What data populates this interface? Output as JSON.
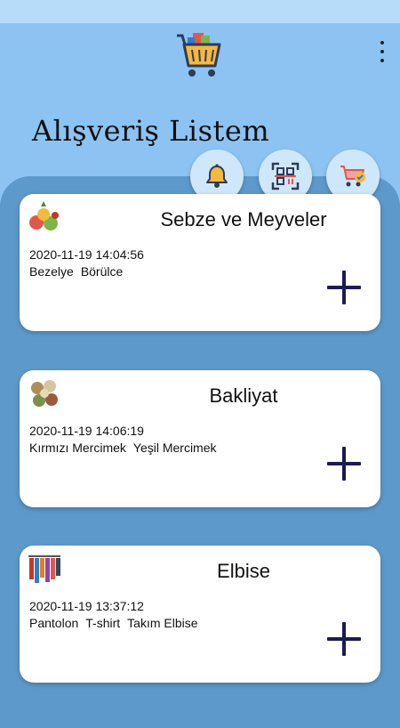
{
  "app": {
    "title": "Alışveriş Listem"
  },
  "header": {
    "logo_icon": "shopping-basket-icon",
    "menu_icon": "more-vertical-icon"
  },
  "actions": [
    {
      "icon": "bell-icon"
    },
    {
      "icon": "qr-code-scan-icon"
    },
    {
      "icon": "cart-check-icon"
    }
  ],
  "cards": [
    {
      "title": "Sebze ve Meyveler",
      "date": "2020-11-19 14:04:56",
      "items": [
        "Bezelye",
        "Börülce"
      ],
      "thumb": "vegetables-fruits-icon"
    },
    {
      "title": "Bakliyat",
      "date": "2020-11-19 14:06:19",
      "items": [
        "Kırmızı Mercimek",
        "Yeşil Mercimek"
      ],
      "thumb": "legumes-icon"
    },
    {
      "title": "Elbise",
      "date": "2020-11-19 13:37:12",
      "items": [
        "Pantolon",
        "T-shirt",
        "Takım Elbise"
      ],
      "thumb": "clothes-rack-icon"
    }
  ],
  "colors": {
    "background": "#8cc3f2",
    "panel": "#5d9acb",
    "button": "#cfe7fb",
    "plus": "#1b1b55"
  }
}
